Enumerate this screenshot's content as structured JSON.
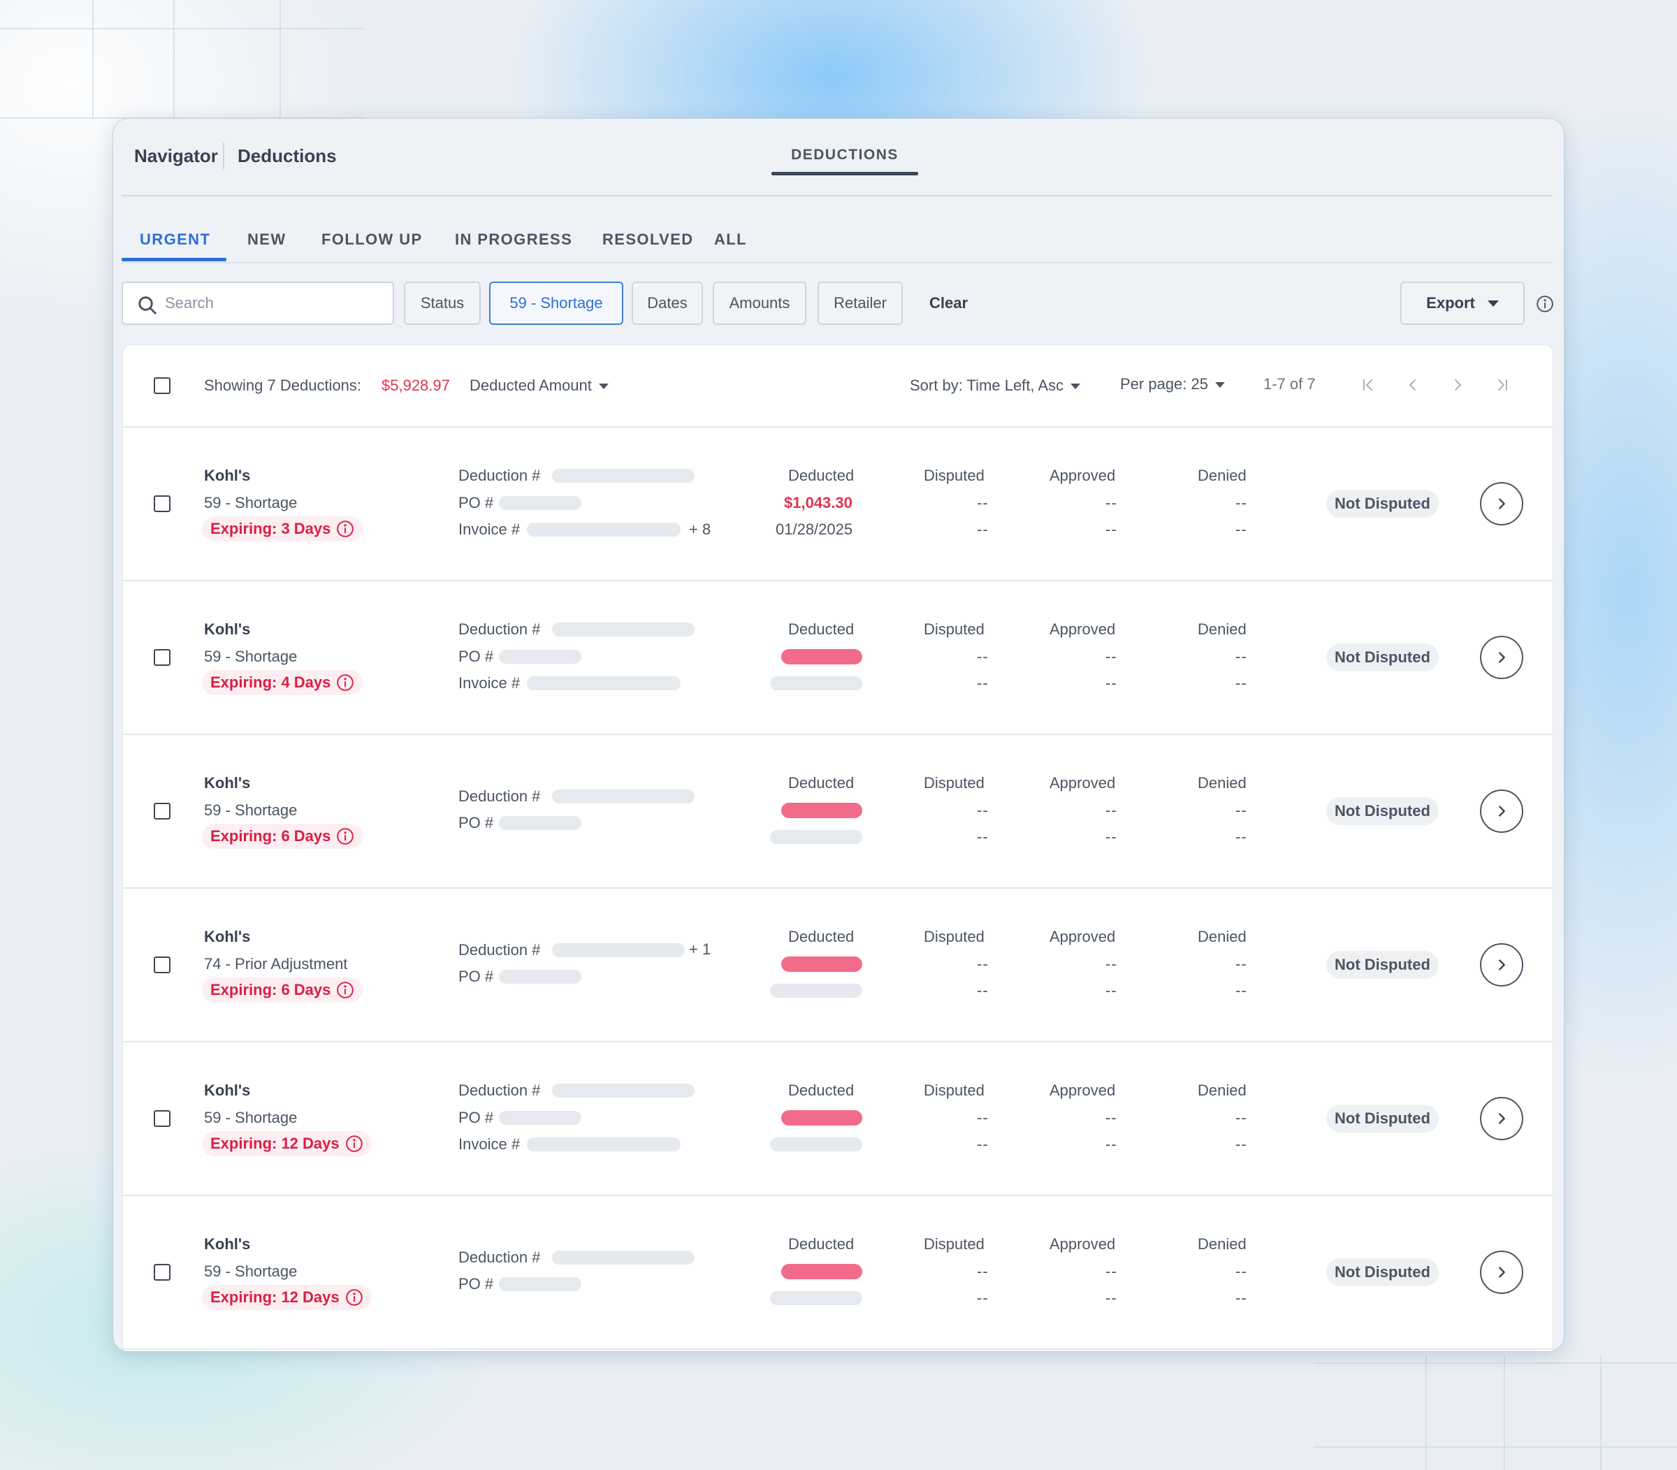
{
  "header": {
    "breadcrumb": [
      "Navigator",
      "Deductions"
    ],
    "main_tab": "DEDUCTIONS"
  },
  "status_tabs": [
    "URGENT",
    "NEW",
    "FOLLOW UP",
    "IN PROGRESS",
    "RESOLVED",
    "ALL"
  ],
  "active_status_tab": "URGENT",
  "filters": {
    "search_placeholder": "Search",
    "status": "Status",
    "reason_chip": "59 - Shortage",
    "dates": "Dates",
    "amounts": "Amounts",
    "retailer": "Retailer",
    "clear": "Clear",
    "export": "Export"
  },
  "list_header": {
    "showing": "Showing 7 Deductions:",
    "total": "$5,928.97",
    "amount_selector": "Deducted Amount",
    "sort": "Sort by: Time Left, Asc",
    "per_page": "Per page: 25",
    "range": "1-7 of 7"
  },
  "column_labels": {
    "deduction_no": "Deduction #",
    "po_no": "PO #",
    "invoice_no": "Invoice #",
    "deducted": "Deducted",
    "disputed": "Disputed",
    "approved": "Approved",
    "denied": "Denied",
    "empty_value": "--"
  },
  "rows": [
    {
      "retailer": "Kohl's",
      "reason": "59 - Shortage",
      "expiring": "Expiring: 3 Days",
      "show_invoice": true,
      "deduction_extra": "",
      "invoice_extra": "+ 8",
      "deducted_amount": "$1,043.30",
      "deducted_date": "01/28/2025",
      "status": "Not Disputed"
    },
    {
      "retailer": "Kohl's",
      "reason": "59 - Shortage",
      "expiring": "Expiring: 4 Days",
      "show_invoice": true,
      "deduction_extra": "",
      "invoice_extra": "",
      "deducted_amount": "",
      "deducted_date": "",
      "status": "Not Disputed"
    },
    {
      "retailer": "Kohl's",
      "reason": "59 - Shortage",
      "expiring": "Expiring: 6 Days",
      "show_invoice": false,
      "deduction_extra": "",
      "invoice_extra": "",
      "deducted_amount": "",
      "deducted_date": "",
      "status": "Not Disputed"
    },
    {
      "retailer": "Kohl's",
      "reason": "74 - Prior Adjustment",
      "expiring": "Expiring: 6 Days",
      "show_invoice": false,
      "deduction_extra": "+ 1",
      "invoice_extra": "",
      "deducted_amount": "",
      "deducted_date": "",
      "status": "Not Disputed"
    },
    {
      "retailer": "Kohl's",
      "reason": "59 - Shortage",
      "expiring": "Expiring: 12 Days",
      "show_invoice": true,
      "deduction_extra": "",
      "invoice_extra": "",
      "deducted_amount": "",
      "deducted_date": "",
      "status": "Not Disputed"
    },
    {
      "retailer": "Kohl's",
      "reason": "59 - Shortage",
      "expiring": "Expiring: 12 Days",
      "show_invoice": false,
      "deduction_extra": "",
      "invoice_extra": "",
      "deducted_amount": "",
      "deducted_date": "",
      "status": "Not Disputed"
    }
  ],
  "icons": {
    "search": "search-icon",
    "info": "info-icon",
    "first_page": "first-page-icon",
    "prev_page": "chevron-left-icon",
    "next_page": "chevron-right-icon",
    "last_page": "last-page-icon",
    "open_row": "chevron-right-icon"
  },
  "colors": {
    "accent_blue": "#2f6fd6",
    "alert_red": "#e0344f",
    "redacted_amount": "#f26b8a"
  }
}
